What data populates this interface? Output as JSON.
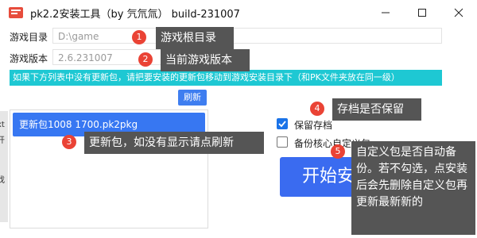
{
  "window": {
    "title": "pk2.2安装工具（by 氕氘氚） build-231007",
    "minimize_icon": "minimize-icon",
    "maximize_icon": "maximize-icon",
    "close_icon": "close-icon"
  },
  "form": {
    "game_dir_label": "游戏目录",
    "game_dir_placeholder": "D:\\game",
    "game_version_label": "游戏版本",
    "game_version_value": "2.6.231007",
    "hint": "如果下方列表中没有更新包，请把要安装的更新包移动到游戏安装目录下（和PK文件夹放在同一级）",
    "refresh_label": "刷新"
  },
  "packages": {
    "items": [
      {
        "label": "更新包1008 1700.pk2pkg",
        "selected": true
      }
    ]
  },
  "options": {
    "keep_save_label": "保留存档",
    "keep_save_checked": true,
    "backup_custom_label": "备份核心自定义包",
    "backup_custom_checked": false
  },
  "start_button_label": "开始安装",
  "left_edge": {
    "text_a": "xt",
    "text_b": "开",
    "text_c": "找"
  },
  "annotations": [
    {
      "number": "1",
      "text": "游戏根目录"
    },
    {
      "number": "2",
      "text": "当前游戏版本"
    },
    {
      "number": "3",
      "text": "更新包，如没有显示请点刷新"
    },
    {
      "number": "4",
      "text": "存档是否保留"
    },
    {
      "number": "5",
      "text": "自定义包是否自动备份。若不勾选，点安装后会先删除自定义包再更新最新新的"
    }
  ],
  "colors": {
    "hint_bar": "#1ec8d3",
    "accent_blue": "#3777f2",
    "badge_red": "#ea4335",
    "tooltip_gray": "#555555"
  }
}
